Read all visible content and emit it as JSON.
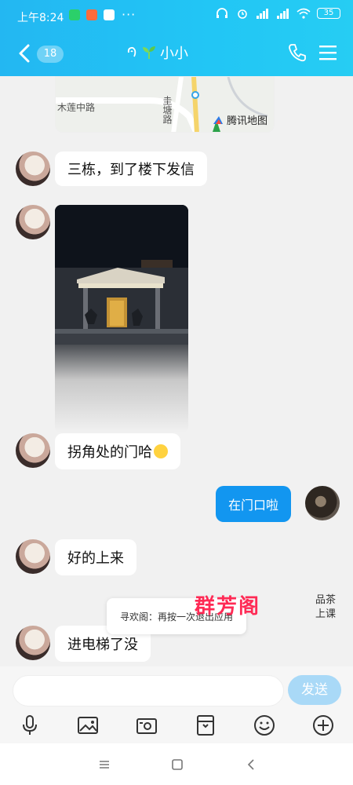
{
  "status_bar": {
    "time": "上午8:24",
    "more": "···",
    "battery": "35"
  },
  "header": {
    "unread_count": "18",
    "title": "小小"
  },
  "messages": [
    {
      "sender": "other",
      "type": "text",
      "text": "三栋，到了楼下发信"
    },
    {
      "sender": "other",
      "type": "image"
    },
    {
      "sender": "other",
      "type": "text",
      "text": "拐角处的门哈"
    },
    {
      "sender": "me",
      "type": "text",
      "text": "在门口啦"
    },
    {
      "sender": "other",
      "type": "text",
      "text": "好的上来"
    },
    {
      "sender": "other",
      "type": "text",
      "text": "进电梯了没"
    }
  ],
  "map_card": {
    "labels": [
      "木莲中路",
      "圭塘路"
    ],
    "provider": "腾讯地图"
  },
  "toast": {
    "text": "寻欢阁：再按一次退出应用"
  },
  "watermark": {
    "name": "群芳阁",
    "sub_line1": "品茶",
    "sub_line2": "上课"
  },
  "composer": {
    "input_value": "",
    "send_label": "发送"
  },
  "icons": {
    "back": "back-icon",
    "phone": "phone-icon",
    "menu": "menu-icon",
    "mic": "microphone-icon",
    "image": "image-icon",
    "camera": "camera-icon",
    "file": "file-icon",
    "emoji": "emoji-icon",
    "plus": "plus-icon"
  },
  "colors": {
    "header": "#23b7f2",
    "my_bubble": "#1296f0",
    "send_disabled": "#a9d9f7"
  }
}
